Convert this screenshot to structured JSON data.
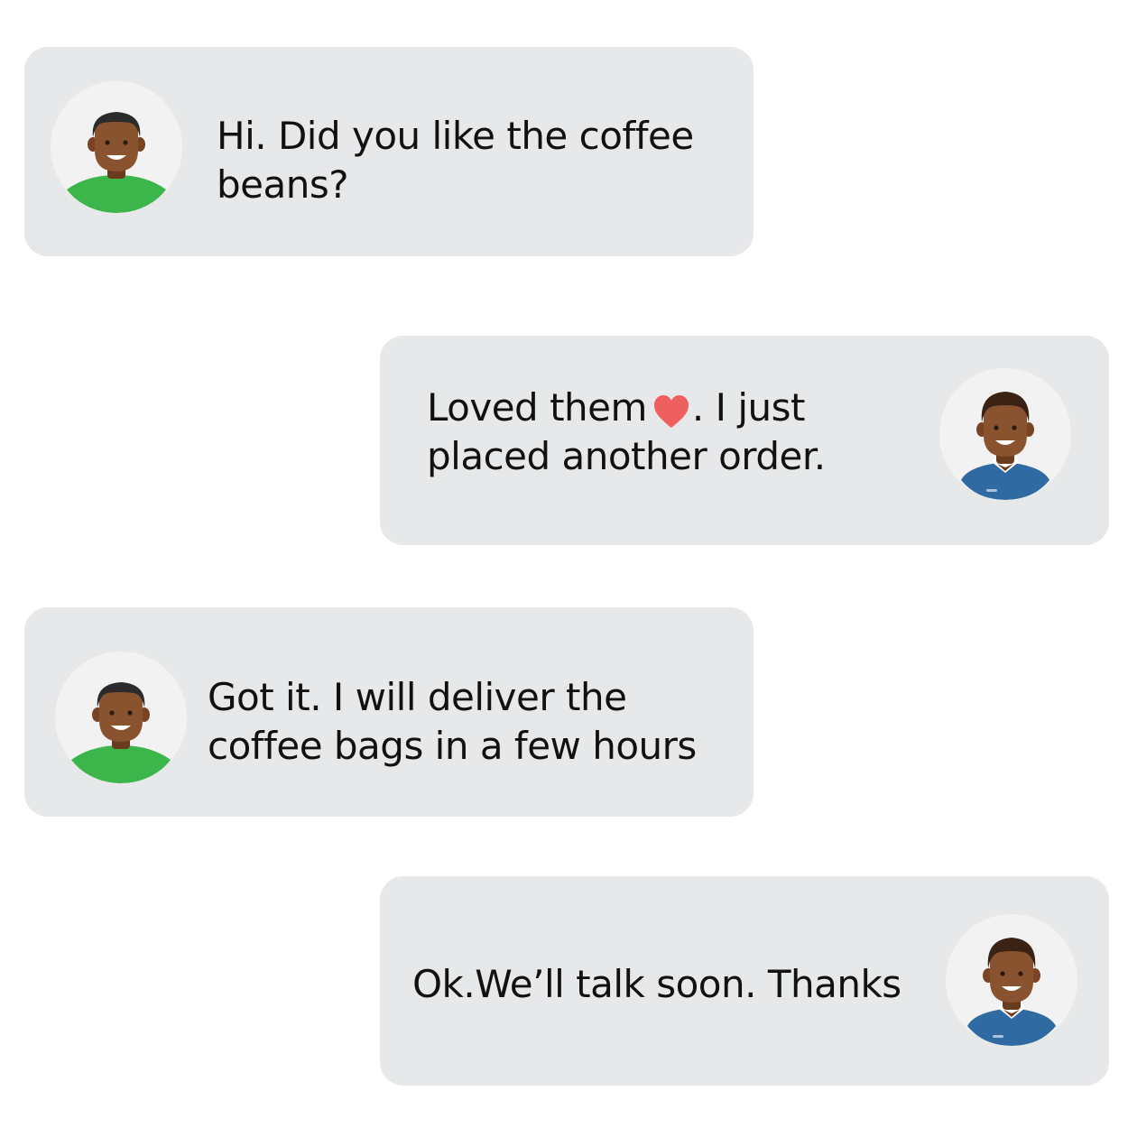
{
  "messages": [
    {
      "sender": "customer",
      "lines": [
        "Hi. Did you like the coffee",
        "beans?"
      ],
      "avatar_icon": "customer-avatar-icon"
    },
    {
      "sender": "user",
      "line1_before": "Loved them",
      "line1_icon": "heart-icon",
      "line1_after": ". I just",
      "line2": "placed another order.",
      "avatar_icon": "user-avatar-icon"
    },
    {
      "sender": "customer",
      "lines": [
        "Got it. I will deliver the",
        "coffee bags in a few hours"
      ],
      "avatar_icon": "customer-avatar-icon"
    },
    {
      "sender": "user",
      "lines": [
        "Ok.We’ll talk soon. Thanks"
      ],
      "avatar_icon": "user-avatar-icon"
    }
  ],
  "colors": {
    "bubble": "#e7e8e9",
    "text": "#111111",
    "heart": "#ef5f5f",
    "shirt_green": "#3cb64a",
    "shirt_blue": "#2f6aa3"
  }
}
